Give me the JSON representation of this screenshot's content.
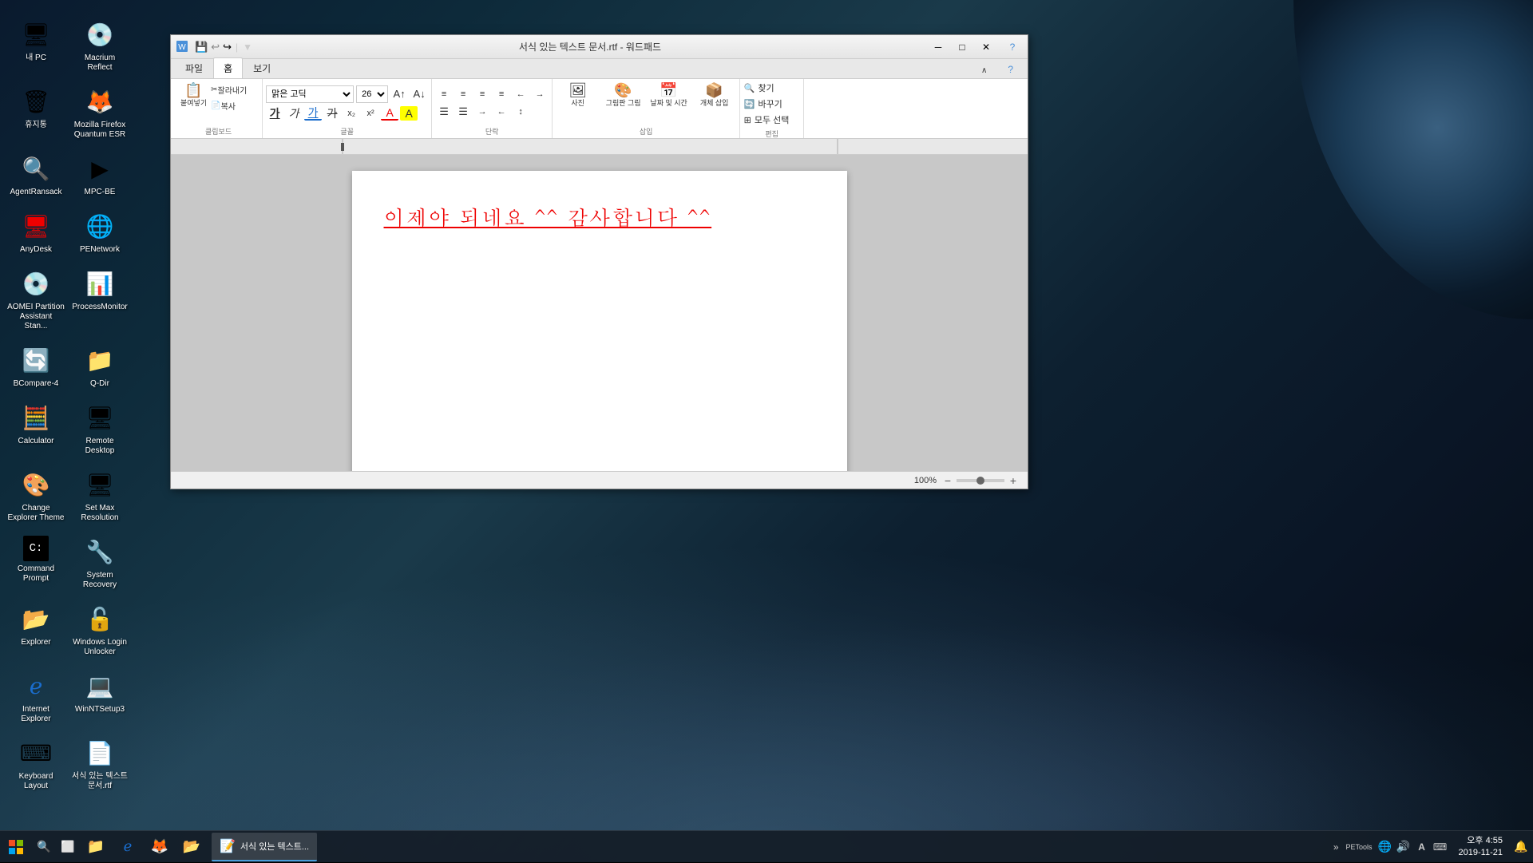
{
  "desktop": {
    "icons": [
      {
        "id": "내PC",
        "label": "내 PC",
        "icon": "🖥",
        "col": 0
      },
      {
        "id": "macrium",
        "label": "Macrium Reflect",
        "icon": "💾",
        "col": 1
      },
      {
        "id": "휴지통",
        "label": "휴지통",
        "icon": "🗑",
        "col": 0
      },
      {
        "id": "firefox",
        "label": "Mozilla Firefox Quantum ESR",
        "icon": "🦊",
        "col": 1
      },
      {
        "id": "agentransack",
        "label": "AgentRansack",
        "icon": "🔍",
        "col": 0
      },
      {
        "id": "mpcbe",
        "label": "MPC-BE",
        "icon": "▶",
        "col": 1
      },
      {
        "id": "anydesk",
        "label": "AnyDesk",
        "icon": "🖥",
        "col": 0
      },
      {
        "id": "penetwork",
        "label": "PENetwork",
        "icon": "🌐",
        "col": 1
      },
      {
        "id": "aomei",
        "label": "AOMEI Partition Assistant Stan...",
        "icon": "💿",
        "col": 0
      },
      {
        "id": "processmonitor",
        "label": "ProcessMonitor",
        "icon": "📊",
        "col": 1
      },
      {
        "id": "bcompare",
        "label": "BCompare-4",
        "icon": "🔄",
        "col": 0
      },
      {
        "id": "qdir",
        "label": "Q-Dir",
        "icon": "📁",
        "col": 1
      },
      {
        "id": "calculator",
        "label": "Calculator",
        "icon": "🧮",
        "col": 0
      },
      {
        "id": "remotedesktop",
        "label": "Remote Desktop",
        "icon": "🖥",
        "col": 1
      },
      {
        "id": "changeexplorer",
        "label": "Change Explorer Theme",
        "icon": "🎨",
        "col": 0
      },
      {
        "id": "setmax",
        "label": "Set Max Resolution",
        "icon": "🖥",
        "col": 1
      },
      {
        "id": "cmdprompt",
        "label": "Command Prompt",
        "icon": "⚫",
        "col": 0
      },
      {
        "id": "sysrecovery",
        "label": "System Recovery",
        "icon": "🔧",
        "col": 1
      },
      {
        "id": "explorer",
        "label": "Explorer",
        "icon": "📂",
        "col": 0
      },
      {
        "id": "winlogin",
        "label": "Windows Login Unlocker",
        "icon": "🔓",
        "col": 1
      },
      {
        "id": "ie",
        "label": "Internet Explorer",
        "icon": "🌐",
        "col": 0
      },
      {
        "id": "winntsetup",
        "label": "WinNTSetup3",
        "icon": "💻",
        "col": 1
      },
      {
        "id": "keyboard",
        "label": "Keyboard Layout",
        "icon": "⌨",
        "col": 0
      },
      {
        "id": "wordpad_doc",
        "label": "서식 있는 텍스트 문서.rtf",
        "icon": "📄",
        "col": 1
      }
    ]
  },
  "wordpad": {
    "titlebar": {
      "title": "서식 있는 텍스트 문서.rtf - 워드패드",
      "appicon": "📝",
      "minimize": "─",
      "maximize": "□",
      "close": "✕"
    },
    "quick_access": {
      "save": "💾",
      "undo": "↩",
      "redo": "↪",
      "title": "서식 있는 텍스트 문서.rtf - 워드패드",
      "help": "?"
    },
    "tabs": [
      {
        "id": "파일",
        "label": "파일",
        "active": false
      },
      {
        "id": "홈",
        "label": "홈",
        "active": true
      },
      {
        "id": "보기",
        "label": "보기",
        "active": false
      }
    ],
    "ribbon": {
      "clipboard": {
        "label": "클립보드",
        "paste": "붙여넣기",
        "cut": "잘라내기",
        "copy": "복사"
      },
      "font": {
        "label": "글꼴",
        "name": "맑은 고딕",
        "size": "26",
        "bold": "가",
        "italic": "가",
        "underline": "가",
        "strikethrough": "가",
        "subscript": "x",
        "superscript": "x",
        "fontcolor": "A",
        "highlight": "A"
      },
      "paragraph": {
        "label": "단락",
        "left": "≡",
        "center": "≡",
        "right": "≡",
        "justify": "≡",
        "ltr": "←",
        "rtl": "→",
        "bullets": "☰",
        "numbering": "☰",
        "indent_more": "→",
        "indent_less": "←",
        "linespacing": "↕"
      },
      "insert": {
        "label": "삽입",
        "picture": "사진",
        "paintdrawing": "그림판 그림",
        "datetime": "날짜 및 시간",
        "object": "개체 삽입"
      },
      "edit": {
        "label": "편집",
        "find": "찾기",
        "replace": "바꾸기",
        "selectall": "모두 선택"
      }
    },
    "document": {
      "content": "이제야  되네요 ^^  감사합니다 ^^",
      "zoom": "100%"
    }
  },
  "taskbar": {
    "start_icon": "⊞",
    "file_explorer": "📁",
    "ie_icon": "🌐",
    "firefox_icon": "🦊",
    "folder_icon": "📂",
    "open_app": {
      "label": "서식 있는 텍스트...",
      "icon": "📝"
    },
    "show_more": "»",
    "tray": {
      "network": "🌐",
      "volume": "🔊",
      "battery": "🔋",
      "language": "A",
      "clock_time": "오후 4:55",
      "clock_date": "2019-11-21",
      "notifications": "🔔",
      "petools": "PETools"
    }
  }
}
